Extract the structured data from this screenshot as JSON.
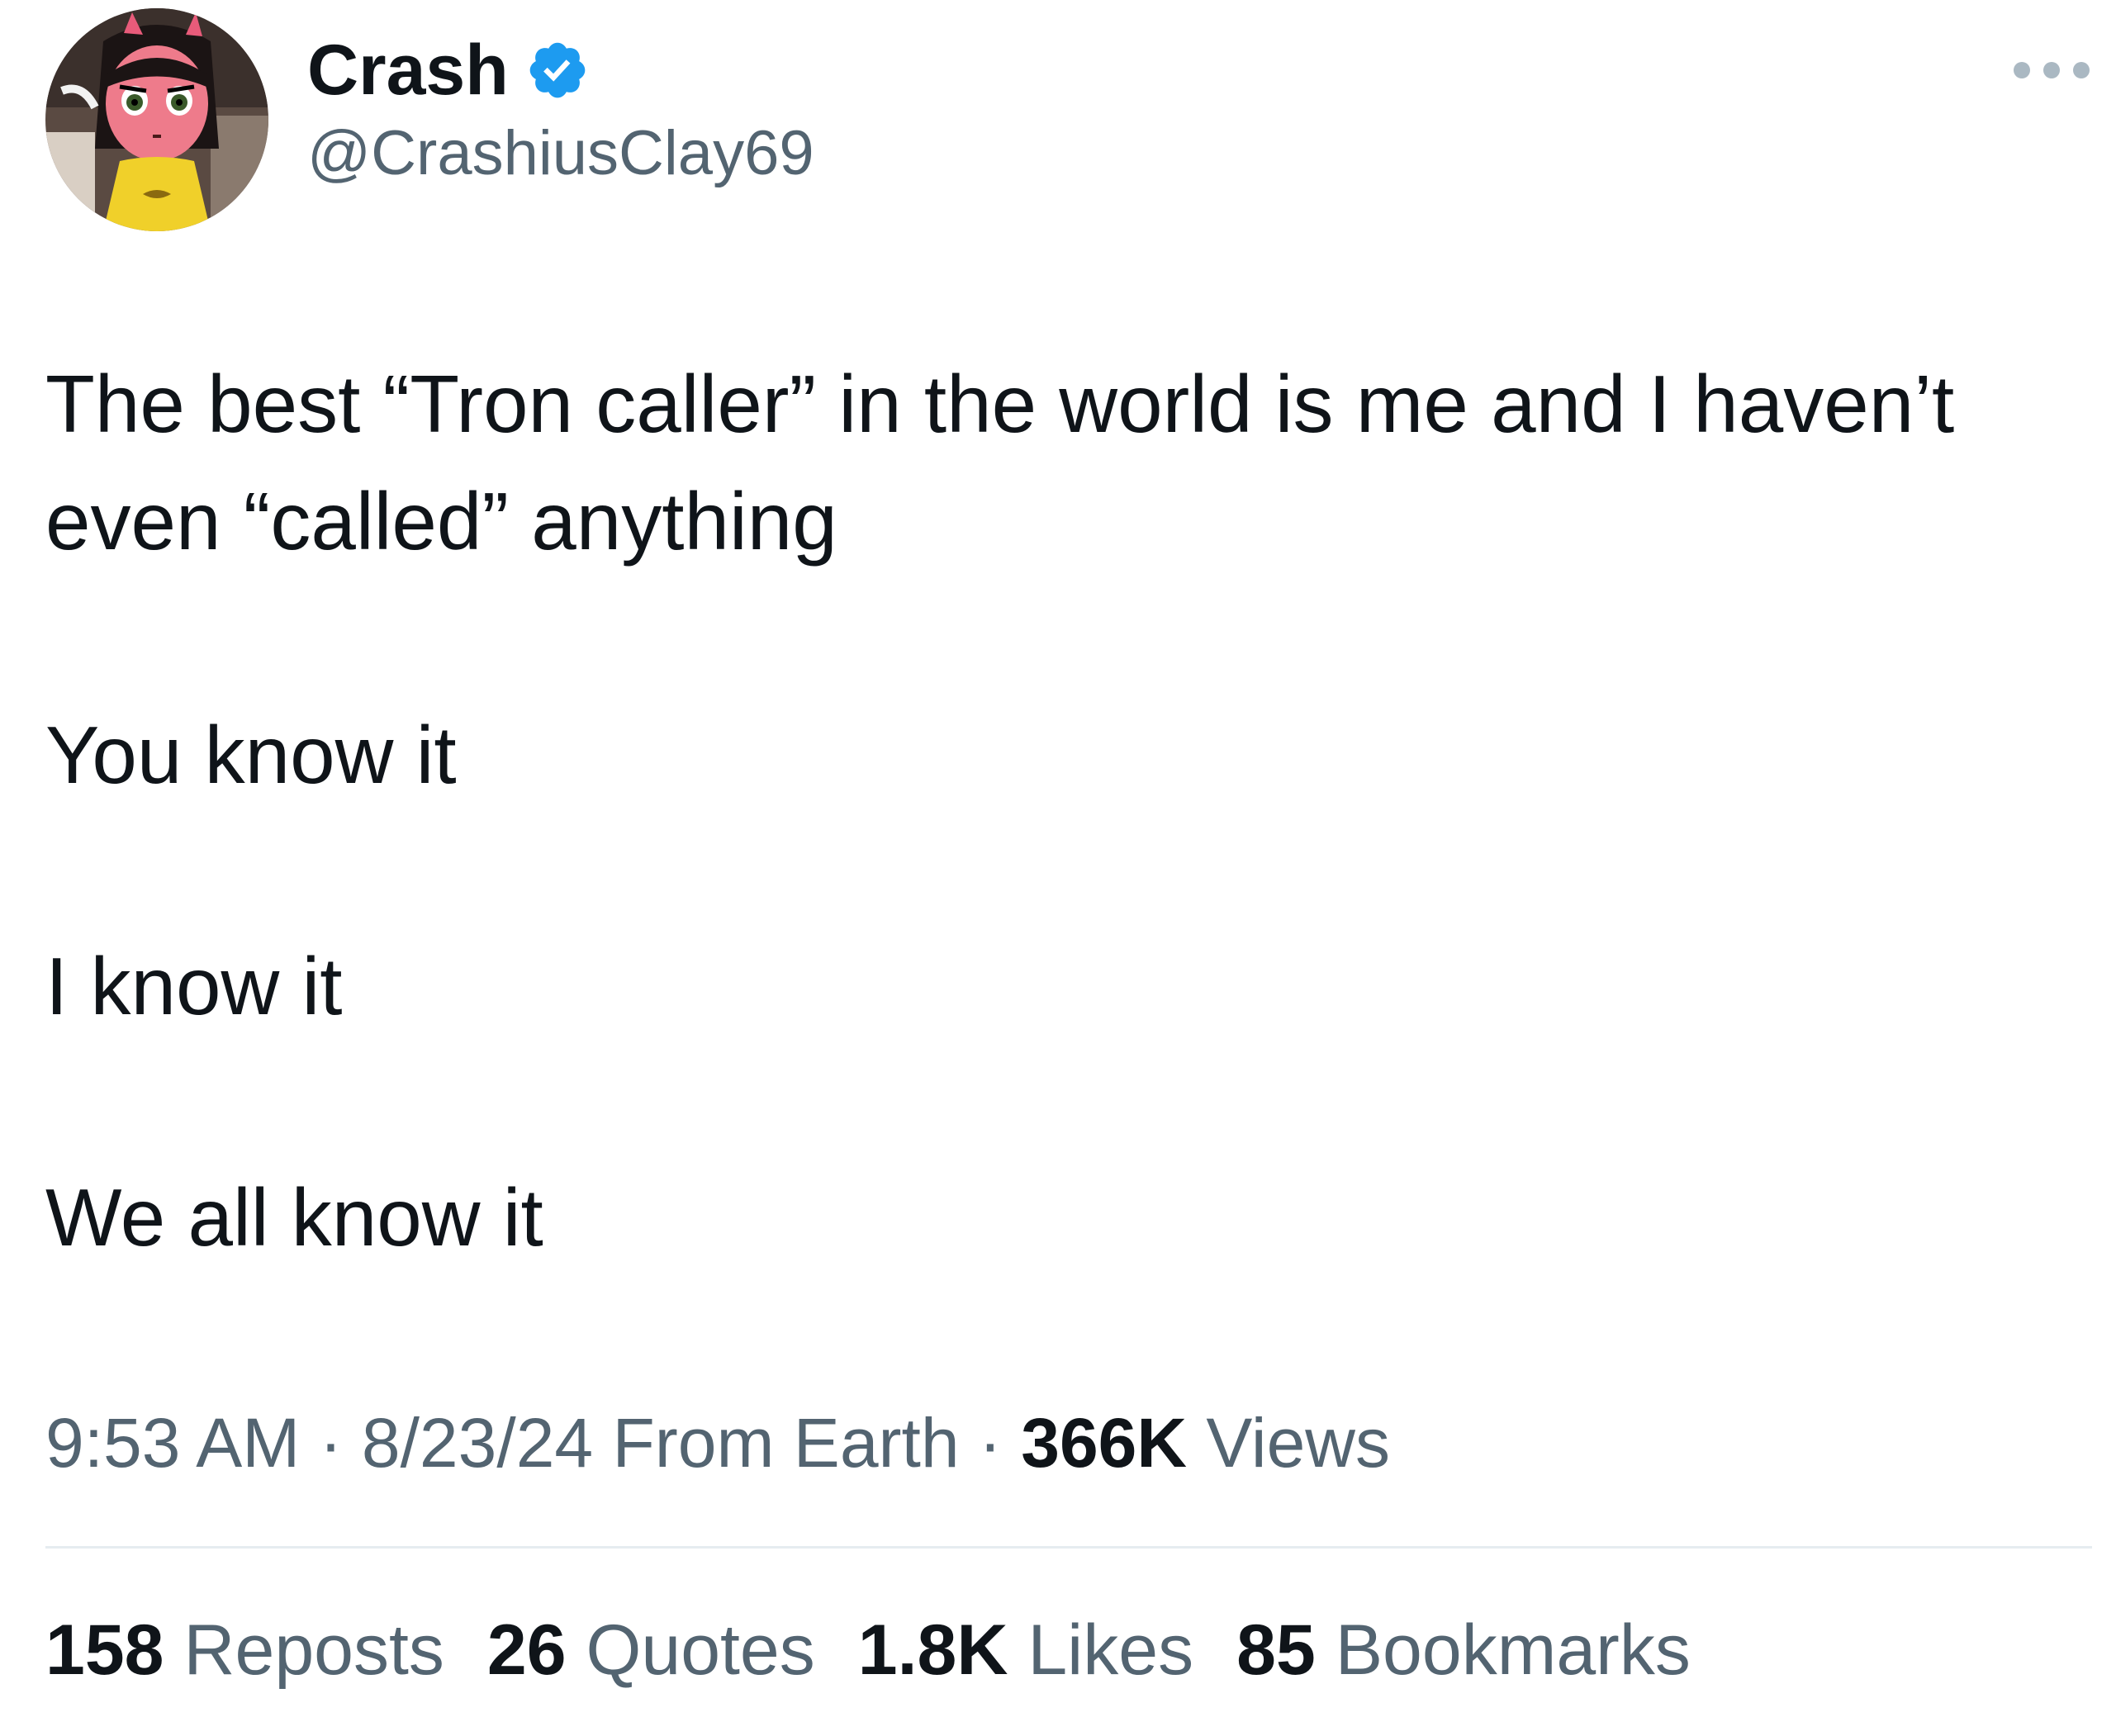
{
  "author": {
    "display_name": "Crash",
    "handle": "@CrashiusClay69",
    "verified": true,
    "avatar": "avatar-cartoon-girl-pink-face-yellow-shirt"
  },
  "menu_icon": "more-horizontal-icon",
  "tweet": {
    "lines": [
      "The best “Tron caller” in the world is me and I haven’t even “called” anything",
      "You know it",
      "I know it",
      "We all know it"
    ]
  },
  "meta": {
    "time": "9:53 AM",
    "date": "8/23/24",
    "source": "From Earth",
    "separator": "·",
    "views_count": "366K",
    "views_label": "Views"
  },
  "stats": {
    "reposts_count": "158",
    "reposts_label": "Reposts",
    "quotes_count": "26",
    "quotes_label": "Quotes",
    "likes_count": "1.8K",
    "likes_label": "Likes",
    "bookmarks_count": "85",
    "bookmarks_label": "Bookmarks"
  },
  "colors": {
    "verified_blue": "#1d9bf0",
    "text_primary": "#0f1419",
    "text_secondary": "#536471",
    "divider": "#e6ecf0"
  }
}
